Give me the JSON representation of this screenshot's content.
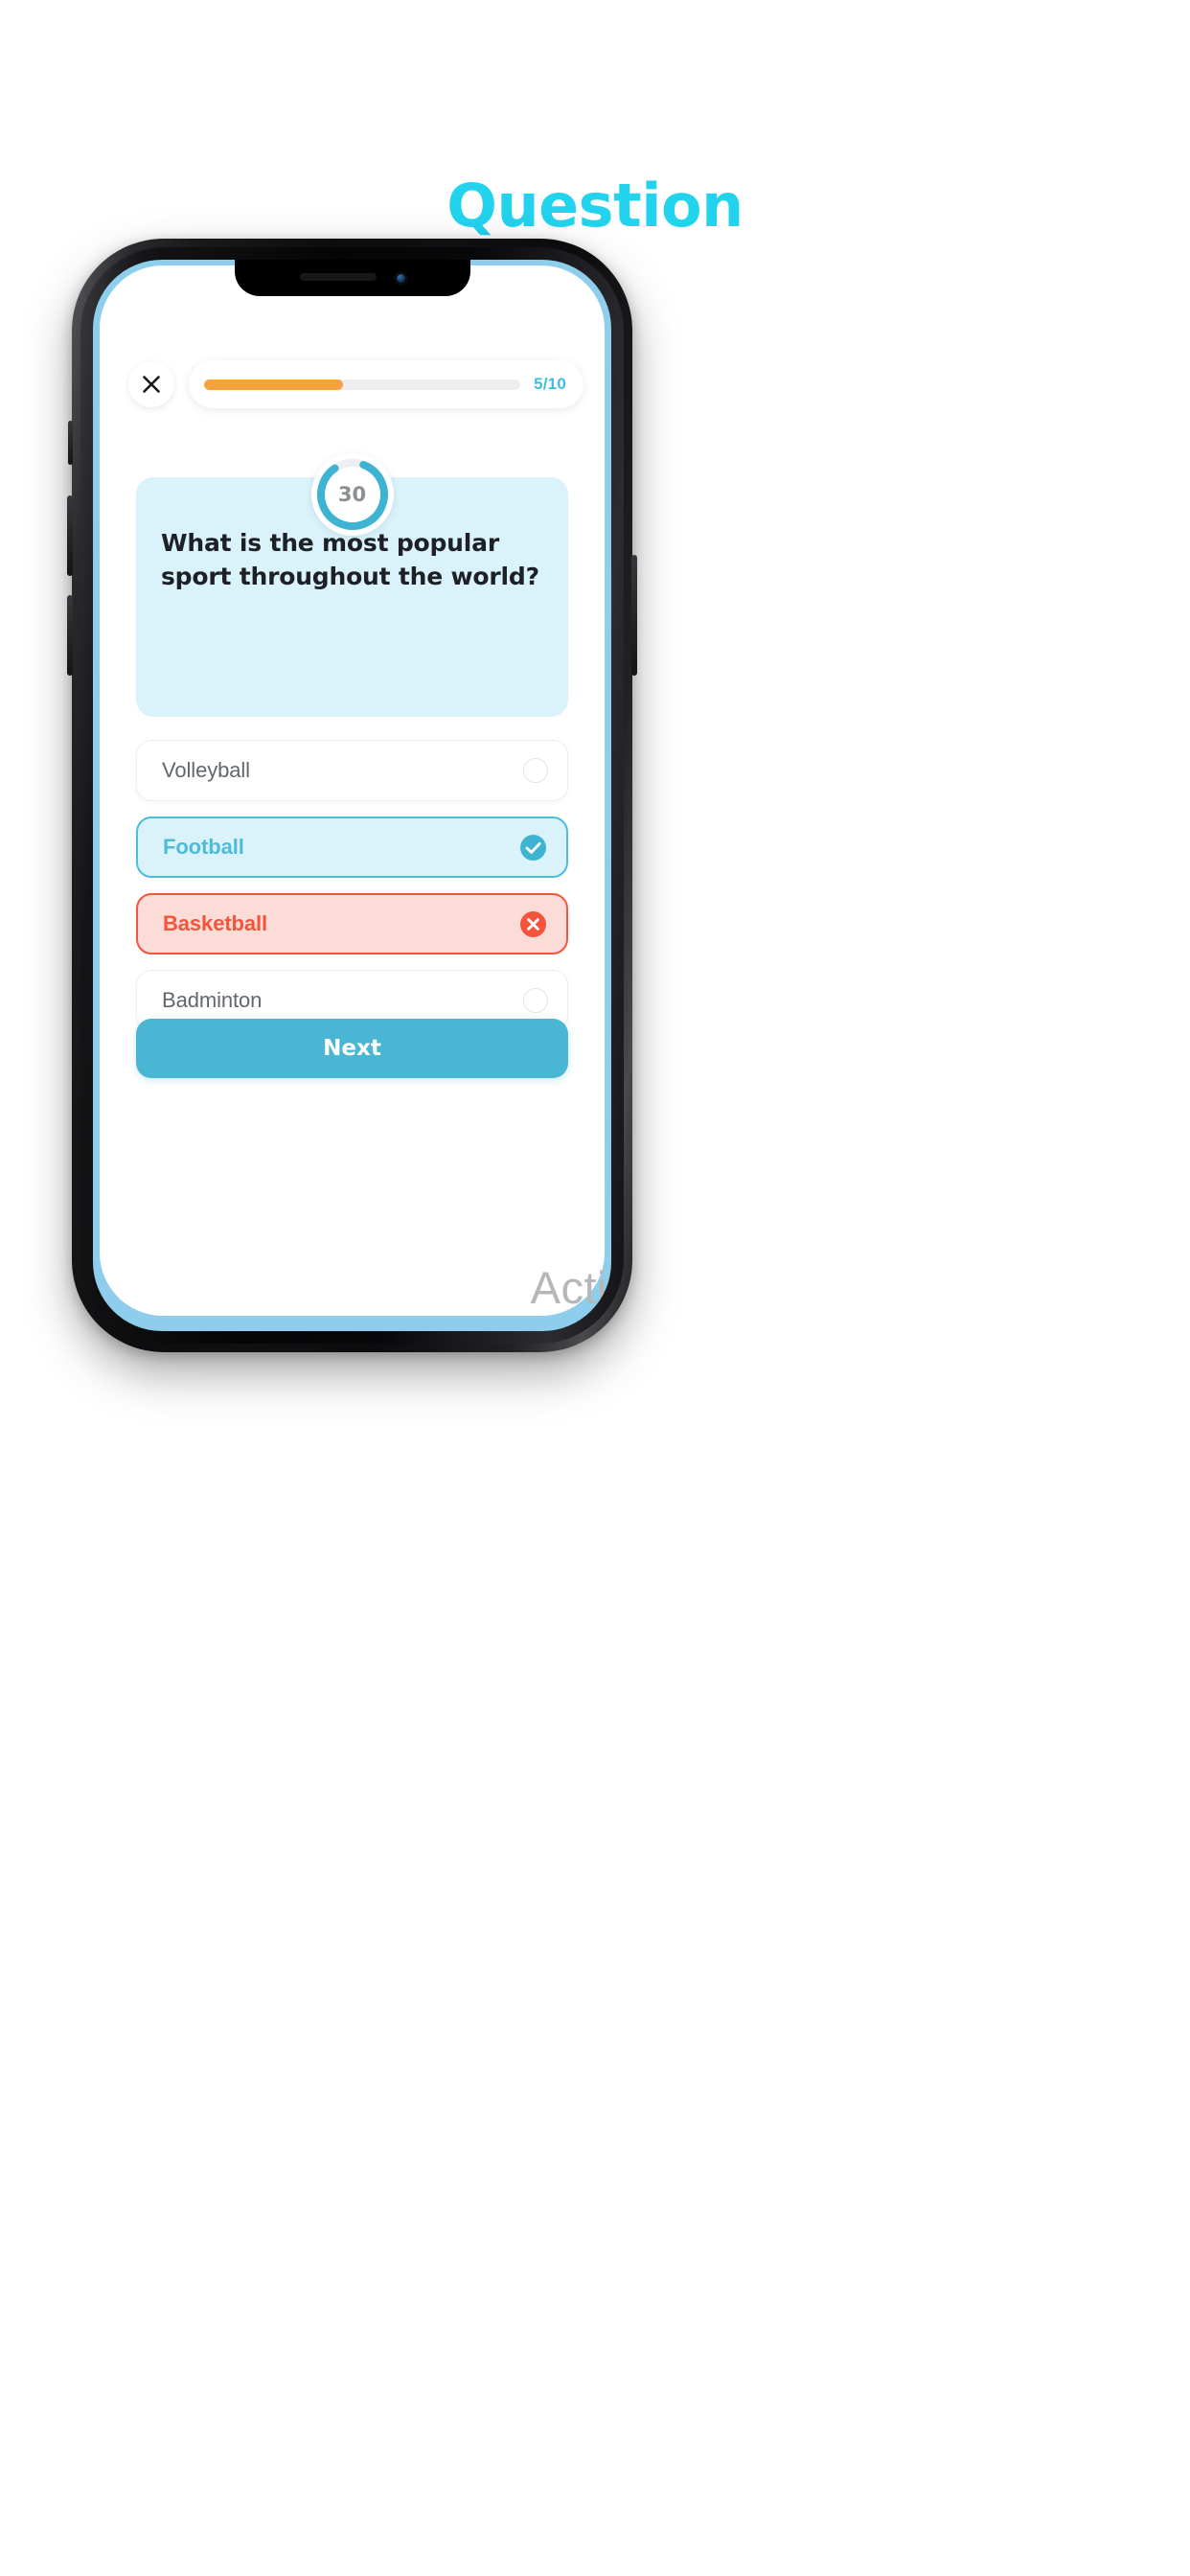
{
  "page": {
    "title": "Question",
    "title_color": "#22D3EE",
    "background": "#FFFFFF"
  },
  "device": {
    "type": "smartphone-mockup",
    "screen_edge_color": "#8ECDEB"
  },
  "app": {
    "topbar": {
      "close_icon": "close-icon",
      "progress": {
        "current": "5",
        "total": "10",
        "label": "5/10",
        "percent": 44,
        "fill_color": "#F9A03F",
        "track_color": "#EEEEEE",
        "label_color": "#3FBEDC"
      }
    },
    "timer": {
      "value": "30",
      "percent": 85,
      "ring_color": "#3FB4D2",
      "ring_track_color": "#EDEFF0"
    },
    "question": {
      "text": "What is the most popular sport throughout the world?",
      "card_color": "#DAF2FA",
      "text_color": "#1D2024"
    },
    "options": [
      {
        "label": "Volleyball",
        "state": "neutral",
        "icon": "radio-empty-icon",
        "background": "#FFFFFF",
        "border": "#ECEFF1",
        "text_color": "#62676C"
      },
      {
        "label": "Football",
        "state": "correct",
        "icon": "check-circle-icon",
        "background": "#DAF3FB",
        "border": "#4FBBD8",
        "text_color": "#4FBBD8"
      },
      {
        "label": "Basketball",
        "state": "wrong",
        "icon": "x-circle-icon",
        "background": "#FCDCD6",
        "border": "#F4543C",
        "text_color": "#F4543C"
      },
      {
        "label": "Badminton",
        "state": "neutral",
        "icon": "radio-empty-icon",
        "background": "#FFFFFF",
        "border": "#ECEFF1",
        "text_color": "#62676C"
      }
    ],
    "next_button": {
      "label": "Next",
      "background": "#49B7D4",
      "text_color": "#FFFFFF"
    },
    "watermark": {
      "text": "Activ",
      "color": "#B7B7B7"
    }
  }
}
